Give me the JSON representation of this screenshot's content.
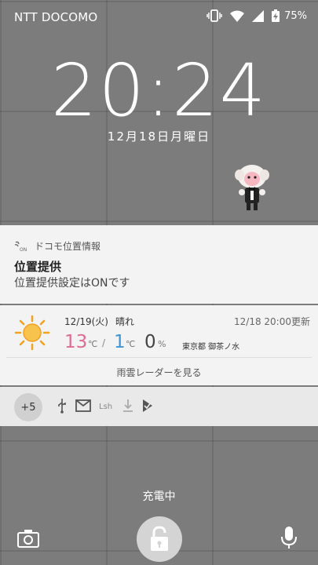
{
  "status_bar": {
    "carrier": "NTT DOCOMO",
    "battery": "75%",
    "icons": [
      "vibrate-icon",
      "wifi-icon",
      "signal-icon",
      "battery-charging-icon"
    ]
  },
  "lockscreen": {
    "time": "20:24",
    "date": "12月18日月曜日",
    "charging_text": "充電中"
  },
  "notifications": {
    "location": {
      "app_name": "ドコモ位置情報",
      "title": "位置提供",
      "text": "位置提供設定はONです",
      "icon": "location-on-icon"
    },
    "weather": {
      "date": "12/19(火)",
      "condition": "晴れ",
      "updated": "12/18 20:00更新",
      "high": "13",
      "low": "1",
      "temp_unit": "℃",
      "separator": "/",
      "precip": "0",
      "precip_unit": "%",
      "location": "東京都 御茶ノ水",
      "link": "雨雲レーダーを見る",
      "icon": "sun-icon"
    },
    "overflow": {
      "more_count": "+5",
      "icons": [
        "usb-icon",
        "mail-icon",
        "lsh-icon",
        "download-icon",
        "check-flag-icon"
      ]
    }
  },
  "colors": {
    "high_temp": "#e06a91",
    "low_temp": "#3f94d4",
    "card_bg": "#f3f3f3"
  }
}
